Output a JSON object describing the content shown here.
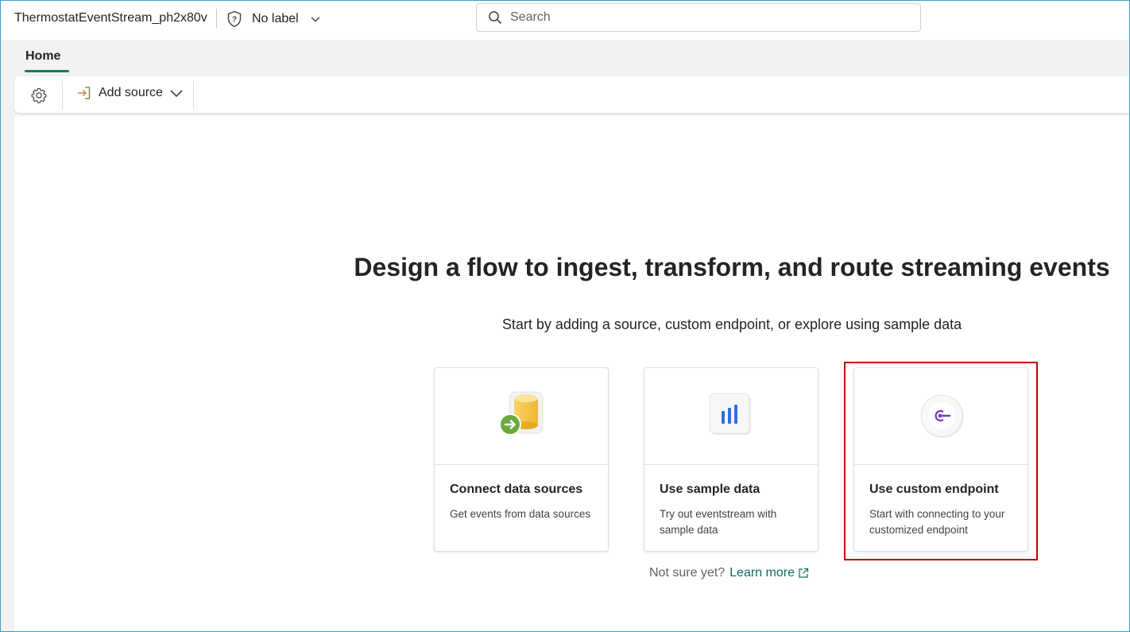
{
  "header": {
    "title": "ThermostatEventStream_ph2x80v",
    "sensitivity_label": "No label",
    "search_placeholder": "Search"
  },
  "tabs": [
    {
      "label": "Home",
      "selected": true
    }
  ],
  "toolbar": {
    "settings_icon": "gear-icon",
    "add_source_label": "Add source"
  },
  "main": {
    "heading": "Design a flow to ingest, transform, and route streaming events",
    "subheading": "Start by adding a source, custom endpoint, or explore using sample data",
    "cards": [
      {
        "title": "Connect data sources",
        "description": "Get events from data sources",
        "icon": "database-arrow-icon"
      },
      {
        "title": "Use sample data",
        "description": "Try out eventstream with sample data",
        "icon": "bar-chart-icon"
      },
      {
        "title": "Use custom endpoint",
        "description": "Start with connecting to your customized endpoint",
        "icon": "endpoint-icon",
        "highlighted": true
      }
    ],
    "help_prompt": "Not sure yet?",
    "learn_more_label": "Learn more"
  },
  "colors": {
    "accent": "#117865",
    "link": "#0f6c5c",
    "highlight_border": "#c00000"
  }
}
